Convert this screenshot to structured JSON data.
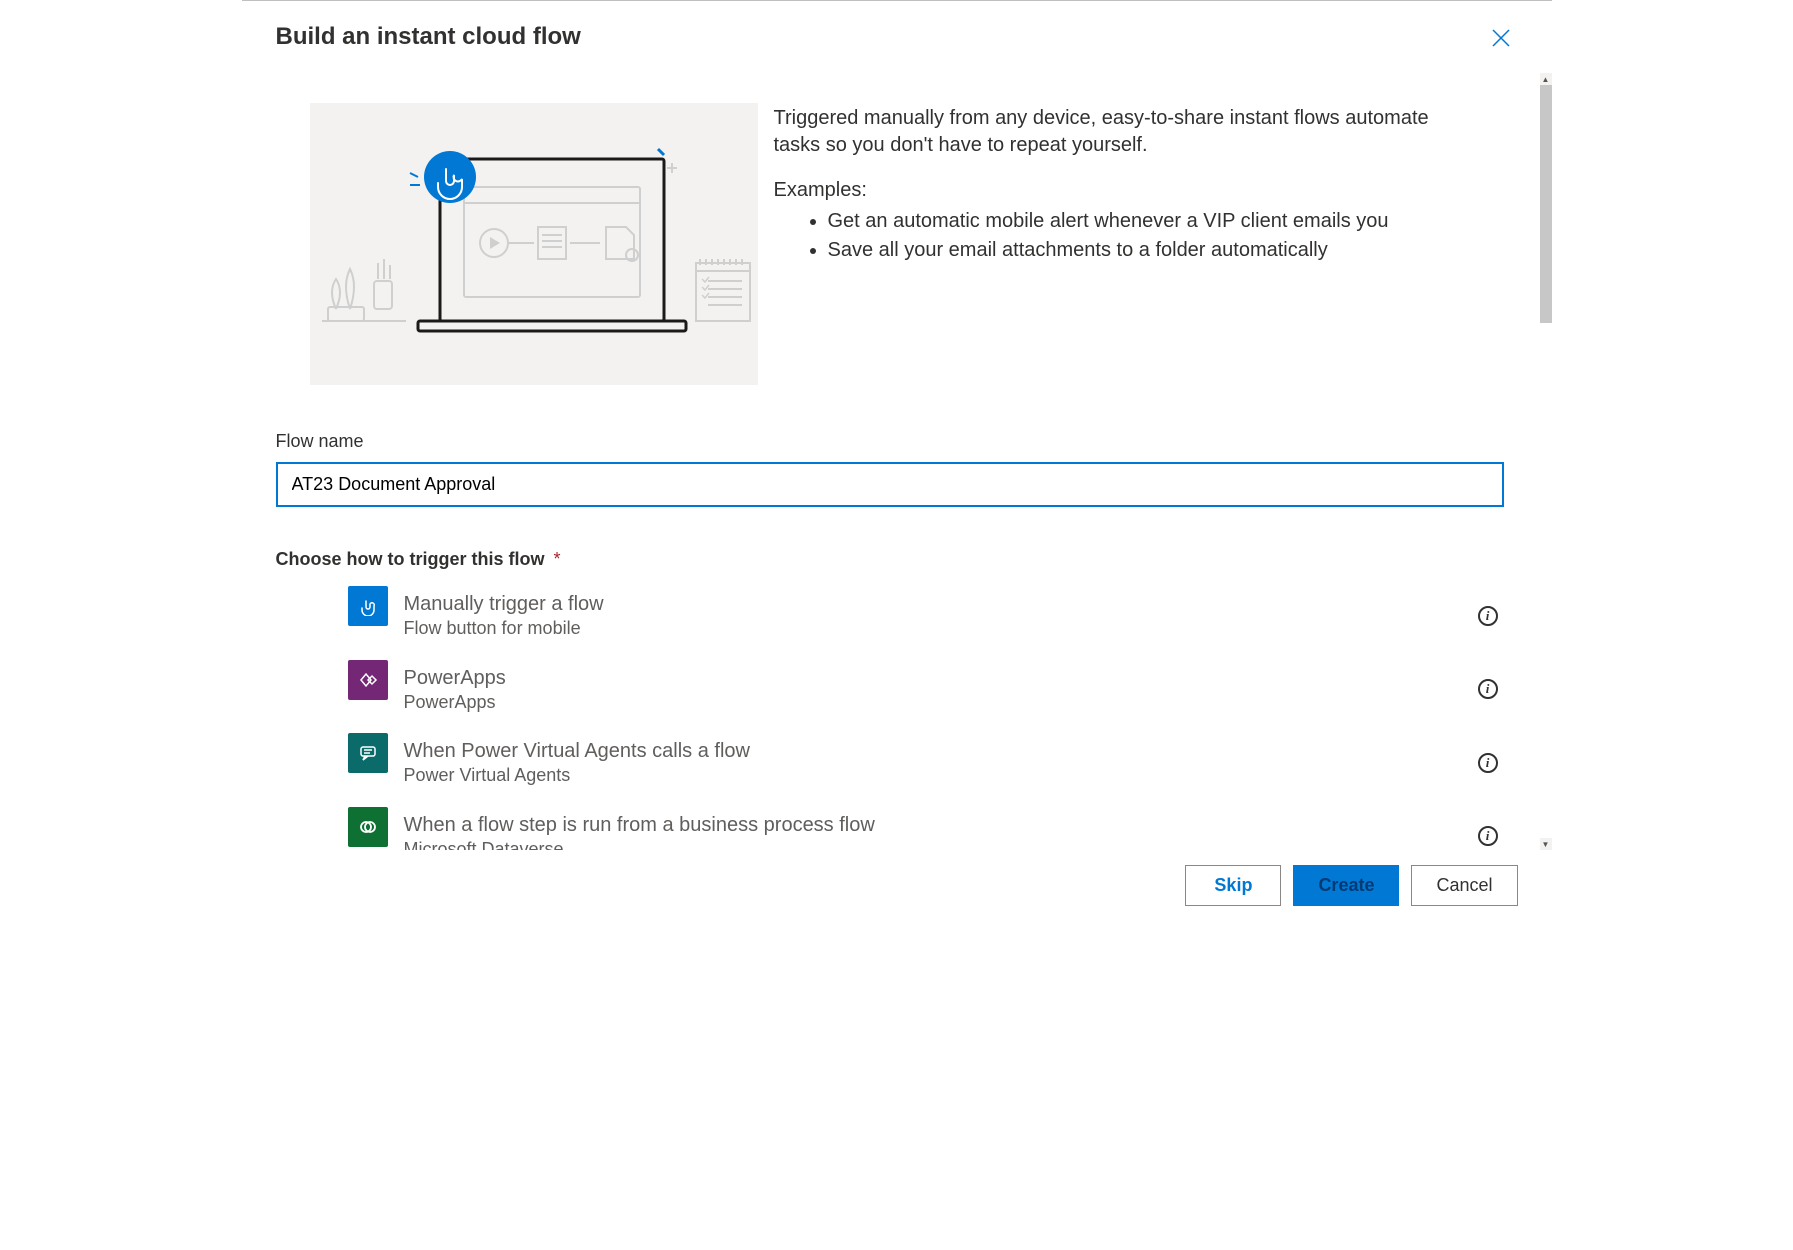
{
  "dialog": {
    "title": "Build an instant cloud flow"
  },
  "hero": {
    "description": "Triggered manually from any device, easy-to-share instant flows automate tasks so you don't have to repeat yourself.",
    "examples_label": "Examples:",
    "examples": [
      "Get an automatic mobile alert whenever a VIP client emails you",
      "Save all your email attachments to a folder automatically"
    ]
  },
  "form": {
    "flow_name_label": "Flow name",
    "flow_name_value": "AT23 Document Approval",
    "trigger_section_label": "Choose how to trigger this flow",
    "trigger_required": "*"
  },
  "triggers": [
    {
      "title": "Manually trigger a flow",
      "subtitle": "Flow button for mobile",
      "icon": "touch-icon",
      "color": "#0078d4"
    },
    {
      "title": "PowerApps",
      "subtitle": "PowerApps",
      "icon": "powerapps-icon",
      "color": "#742774"
    },
    {
      "title": "When Power Virtual Agents calls a flow",
      "subtitle": "Power Virtual Agents",
      "icon": "pva-icon",
      "color": "#0b6a6a"
    },
    {
      "title": "When a flow step is run from a business process flow",
      "subtitle": "Microsoft Dataverse",
      "icon": "dataverse-icon",
      "color": "#0f7033"
    }
  ],
  "footer": {
    "skip": "Skip",
    "create": "Create",
    "cancel": "Cancel"
  }
}
